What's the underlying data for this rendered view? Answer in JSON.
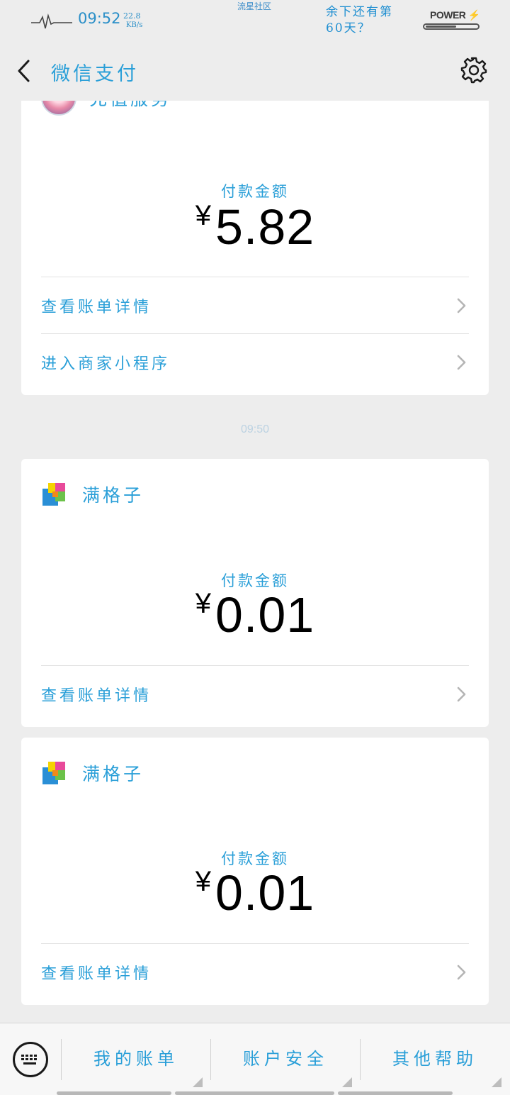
{
  "status_bar": {
    "time": "09:52",
    "speed_value": "22.8",
    "speed_unit": "KB/s",
    "carrier": "流星社区",
    "note_line1": "余下还有第",
    "note_line2": "60天？",
    "power_label": "POWER",
    "battery_level": 0.6
  },
  "header": {
    "title": "微信支付",
    "back_icon": "chevron-left-icon",
    "settings_icon": "gear-icon"
  },
  "messages": [
    {
      "merchant": "充值服务",
      "amount_label": "付款金额",
      "currency": "¥",
      "amount": "5.82",
      "rows": [
        "查看账单详情",
        "进入商家小程序"
      ]
    },
    {
      "time_separator": "09:50"
    },
    {
      "merchant": "满格子",
      "amount_label": "付款金额",
      "currency": "¥",
      "amount": "0.01",
      "rows": [
        "查看账单详情"
      ]
    },
    {
      "merchant": "满格子",
      "amount_label": "付款金额",
      "currency": "¥",
      "amount": "0.01",
      "rows": [
        "查看账单详情"
      ]
    }
  ],
  "bottom_menu": {
    "keyboard_icon": "keyboard-icon",
    "items": [
      "我的账单",
      "账户安全",
      "其他帮助"
    ]
  },
  "colors": {
    "accent": "#2a9fd8",
    "background": "#ededed",
    "card": "#ffffff"
  }
}
